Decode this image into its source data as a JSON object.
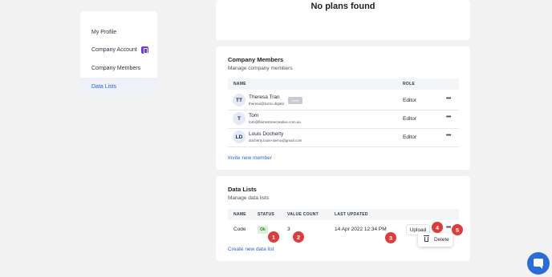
{
  "sidebar": {
    "items": [
      {
        "label": "My Profile"
      },
      {
        "label": "Company Account"
      },
      {
        "label": "Company Members"
      },
      {
        "label": "Data Lists"
      }
    ]
  },
  "plans": {
    "empty_text": "No plans found"
  },
  "members_card": {
    "title": "Company Members",
    "subtitle": "Manage company members",
    "columns": {
      "name": "NAME",
      "role": "ROLE"
    },
    "members": [
      {
        "initials": "TT",
        "name": "Theresa Tran",
        "email": "theresa@komo.digital",
        "badge": "Invite",
        "role": "Editor"
      },
      {
        "initials": "T",
        "name": "Tom",
        "email": "tom@flamestreecreative.com.au",
        "role": "Editor"
      },
      {
        "initials": "LD",
        "name": "Louis Docherty",
        "email": "docherty.louis+demo@gmail.com",
        "role": "Editor"
      }
    ],
    "more": "•••",
    "invite_link": "Invite new member"
  },
  "data_lists_card": {
    "title": "Data Lists",
    "subtitle": "Manage data lists",
    "columns": {
      "name": "NAME",
      "status": "STATUS",
      "value_count": "VALUE COUNT",
      "last_updated": "LAST UPDATED"
    },
    "row": {
      "name": "Code",
      "status": "Ok",
      "value_count": "3",
      "last_updated": "14 Apr 2022 12:34 PM",
      "upload": "Upload"
    },
    "more": "•••",
    "menu": {
      "delete": "Delete"
    },
    "create_link": "Create new data list"
  },
  "markers": [
    "1",
    "2",
    "3",
    "4",
    "5"
  ],
  "colors": {
    "accent": "#2b62d9",
    "marker": "#e03b3b",
    "ok": "#2e7d32",
    "chat": "#2a6cd9"
  }
}
